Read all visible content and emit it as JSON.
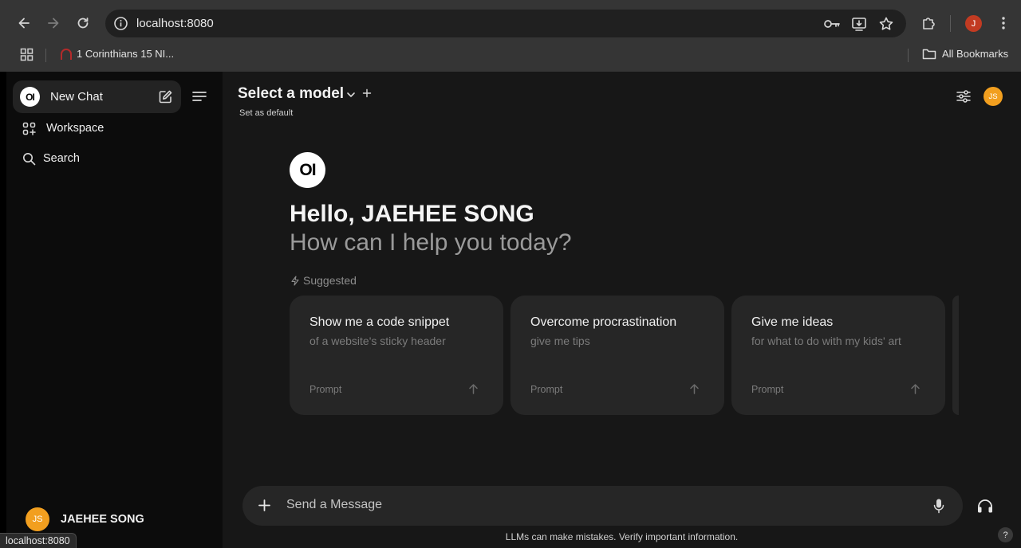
{
  "browser": {
    "url": "localhost:8080",
    "bookmark_item": "1 Corinthians 15 NI...",
    "all_bookmarks": "All Bookmarks",
    "profile_initial": "J",
    "profile_color": "#c23b22",
    "status_url": "localhost:8080"
  },
  "sidebar": {
    "logo_text": "OI",
    "new_chat": "New Chat",
    "items": [
      {
        "label": "Workspace",
        "icon": "workspace-grid-icon"
      },
      {
        "label": "Search",
        "icon": "search-icon"
      }
    ],
    "user": {
      "initials": "JS",
      "name": "JAEHEE SONG",
      "avatar_color": "#f29f1f"
    }
  },
  "header": {
    "model_select": "Select a model",
    "set_default": "Set as default",
    "avatar_initials": "JS"
  },
  "welcome": {
    "logo_text": "OI",
    "greeting": "Hello, JAEHEE SONG",
    "subtitle": "How can I help you today?",
    "suggested_label": "Suggested"
  },
  "suggestions": [
    {
      "title": "Show me a code snippet",
      "subtitle": "of a website's sticky header",
      "tag": "Prompt"
    },
    {
      "title": "Overcome procrastination",
      "subtitle": "give me tips",
      "tag": "Prompt"
    },
    {
      "title": "Give me ideas",
      "subtitle": "for what to do with my kids' art",
      "tag": "Prompt"
    }
  ],
  "composer": {
    "placeholder": "Send a Message",
    "disclaimer": "LLMs can make mistakes. Verify important information.",
    "help": "?"
  }
}
